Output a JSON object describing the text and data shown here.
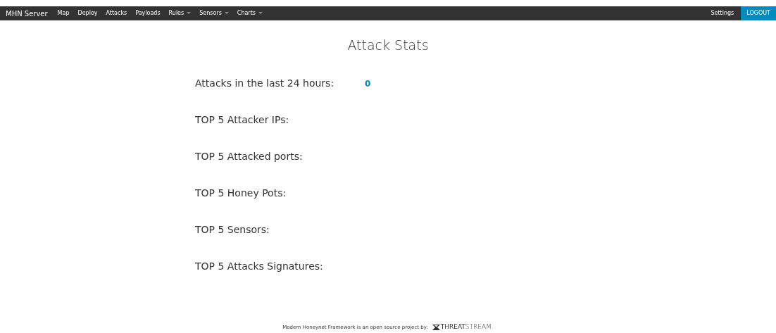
{
  "navbar": {
    "brand": "MHN Server",
    "items": [
      {
        "label": "Map",
        "dropdown": false
      },
      {
        "label": "Deploy",
        "dropdown": false
      },
      {
        "label": "Attacks",
        "dropdown": false
      },
      {
        "label": "Payloads",
        "dropdown": false
      },
      {
        "label": "Rules",
        "dropdown": true
      },
      {
        "label": "Sensors",
        "dropdown": true
      },
      {
        "label": "Charts",
        "dropdown": true
      }
    ],
    "right_items": [
      {
        "label": "Settings",
        "kind": "link"
      },
      {
        "label": "LOGOUT",
        "kind": "button"
      }
    ]
  },
  "title": "Attack Stats",
  "stats": [
    {
      "label": "Attacks in the last 24 hours:",
      "value": "0"
    },
    {
      "label": "TOP 5 Attacker IPs:"
    },
    {
      "label": "TOP 5 Attacked ports:"
    },
    {
      "label": "TOP 5 Honey Pots:"
    },
    {
      "label": "TOP 5 Sensors:"
    },
    {
      "label": "TOP 5 Attacks Signatures:"
    }
  ],
  "footer": {
    "text": "Modern Honeynet Framework is an open source project by:",
    "logo": "**THREAT**STREAM."
  }
}
